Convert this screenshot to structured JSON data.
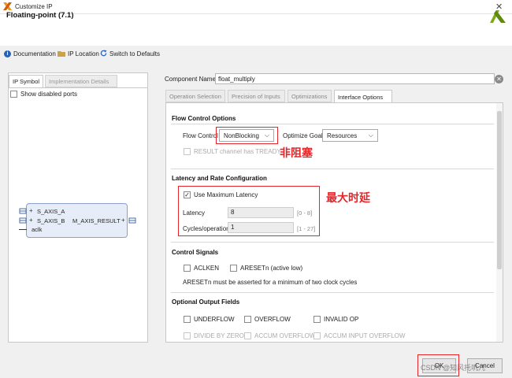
{
  "window": {
    "title": "Customize IP",
    "close_glyph": "✕"
  },
  "header": {
    "ip_title": "Floating-point (7.1)"
  },
  "toolbar": {
    "documentation": "Documentation",
    "ip_location": "IP Location",
    "switch_defaults": "Switch to Defaults"
  },
  "left_panel": {
    "tabs": [
      "IP Symbol",
      "Implementation Details"
    ],
    "show_disabled_ports": "Show disabled ports",
    "symbol": {
      "inputs": [
        "S_AXIS_A",
        "S_AXIS_B"
      ],
      "clock": "aclk",
      "output": "M_AXIS_RESULT"
    }
  },
  "component": {
    "label": "Component Name",
    "value": "float_multiply"
  },
  "tabs": [
    "Operation Selection",
    "Precision of Inputs",
    "Optimizations",
    "Interface Options"
  ],
  "flow_control": {
    "section": "Flow Control Options",
    "flow_label": "Flow Control",
    "flow_value": "NonBlocking",
    "goal_label": "Optimize Goal",
    "goal_value": "Resources",
    "result_tready": "RESULT channel has TREADY"
  },
  "latency": {
    "section": "Latency and Rate Configuration",
    "use_max": "Use Maximum Latency",
    "latency_label": "Latency",
    "latency_value": "8",
    "latency_range": "[0 - 8]",
    "cycles_label": "Cycles/operation",
    "cycles_value": "1",
    "cycles_range": "[1 - 27]"
  },
  "control_signals": {
    "section": "Control Signals",
    "aclken": "ACLKEN",
    "aresetn": "ARESETn (active low)",
    "note": "ARESETn must be asserted for a minimum of two clock cycles"
  },
  "optional_outputs": {
    "section": "Optional Output Fields",
    "underflow": "UNDERFLOW",
    "overflow": "OVERFLOW",
    "invalid_op": "INVALID OP",
    "divide_by_zero": "DIVIDE BY ZERO",
    "accum_overflow": "ACCUM OVERFLOW",
    "accum_input_overflow": "ACCUM INPUT OVERFLOW"
  },
  "annotations": {
    "flow": "非阻塞",
    "latency": "最大时延"
  },
  "buttons": {
    "ok": "OK",
    "cancel": "Cancel"
  },
  "watermark": "CSDN @知风托叽儿",
  "colors": {
    "annotation_red": "#e3262a",
    "accent_blue": "#2a63b5",
    "brand_green": "#7fa817"
  }
}
